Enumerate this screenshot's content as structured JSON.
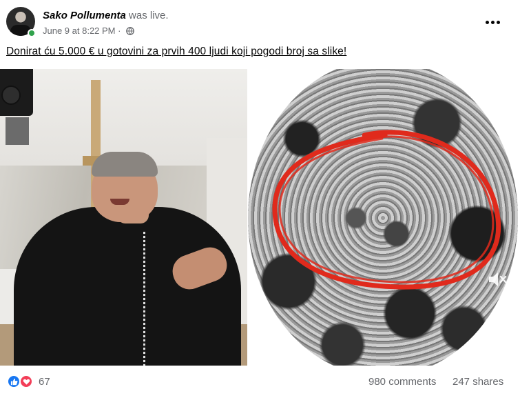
{
  "post": {
    "author": "Sako Pollumenta",
    "action": "was live.",
    "date": "June 9 at 8:22 PM",
    "separator": " · ",
    "audience_icon": "globe-icon",
    "more_icon": "more-options-icon",
    "caption": "Donirat ću 5.000 € u gotovini za prvih 400 ljudi koji pogodi broj sa slike!"
  },
  "video": {
    "mute_icon": "speaker-muted-icon",
    "annotation_color": "#e02a1c"
  },
  "footer": {
    "reactions": [
      "like-icon",
      "love-icon"
    ],
    "reaction_count": "67",
    "comments": "980 comments",
    "shares": "247 shares"
  },
  "colors": {
    "online": "#31a24c",
    "like": "#1877f2",
    "love": "#f33e58",
    "secondary_text": "#65676b"
  }
}
